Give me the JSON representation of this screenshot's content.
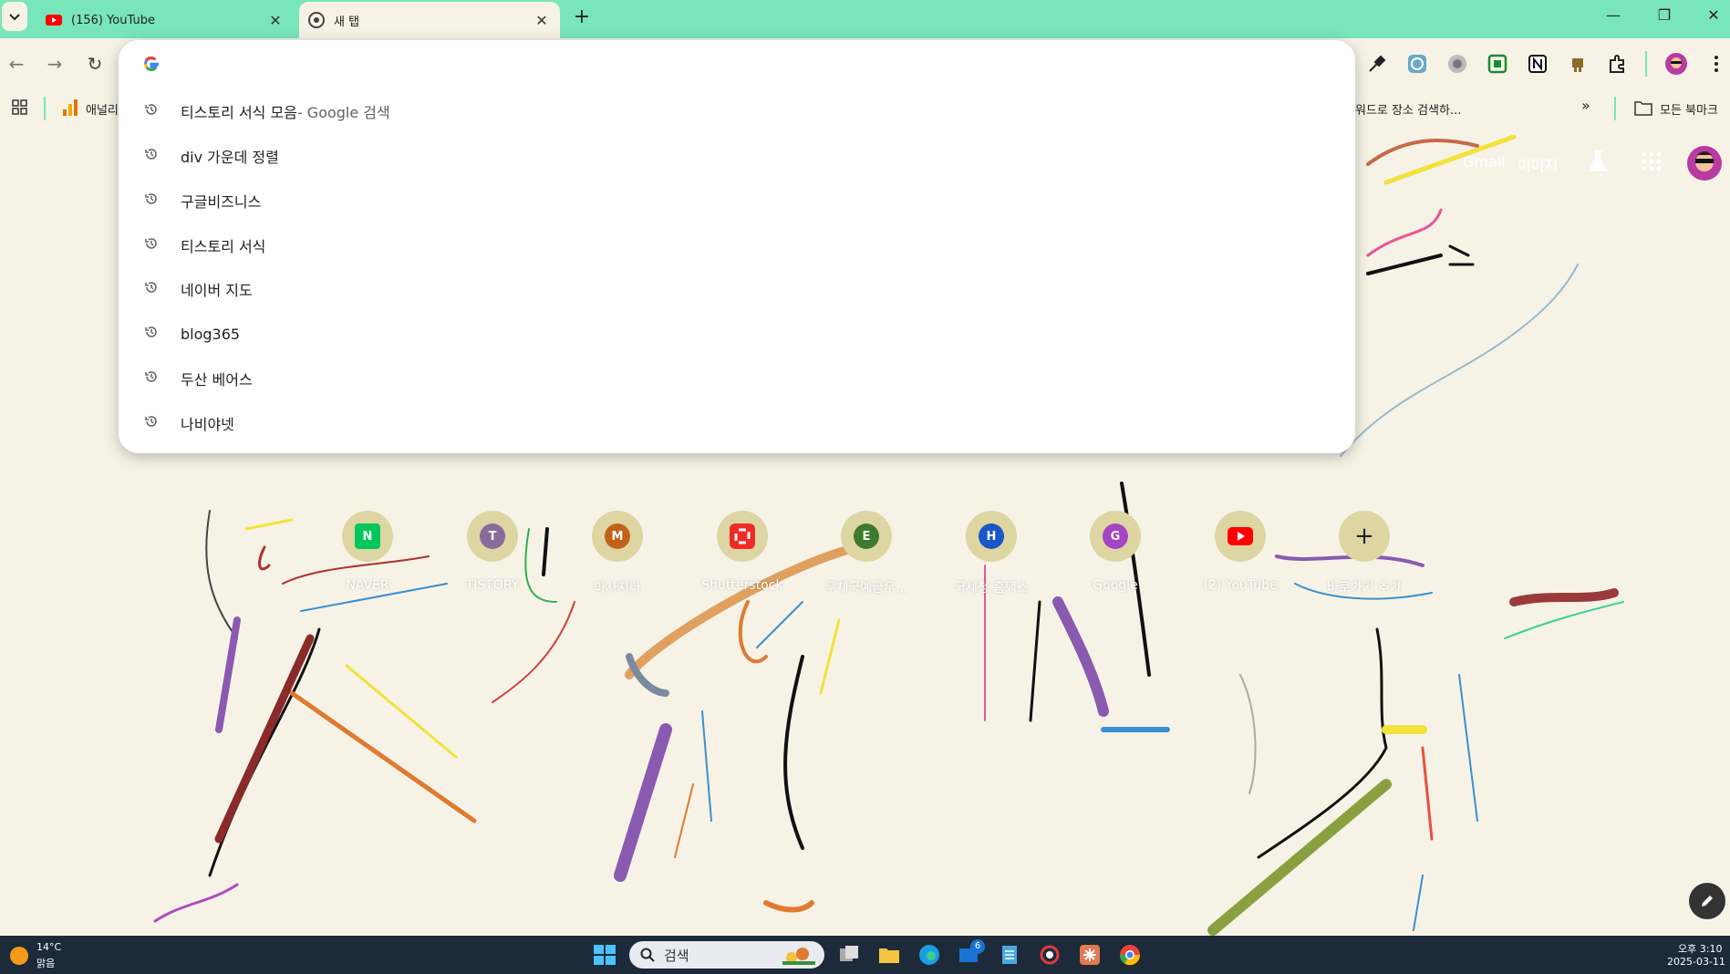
{
  "tabs": [
    {
      "title": "(156) YouTube",
      "icon": "youtube-icon",
      "active": false
    },
    {
      "title": "새 탭",
      "icon": "chrome-icon",
      "active": true
    }
  ],
  "bookmarks": {
    "first": "애널리",
    "second": "워드로 장소 검색하...",
    "all": "모든 북마크"
  },
  "omnibox": {
    "input_value": "",
    "suggestions": [
      {
        "text": "티스토리 서식 모음",
        "sub": " - Google 검색"
      },
      {
        "text": "div 가운데 정렬",
        "sub": ""
      },
      {
        "text": "구글비즈니스",
        "sub": ""
      },
      {
        "text": "티스토리 서식",
        "sub": ""
      },
      {
        "text": "네이버 지도",
        "sub": ""
      },
      {
        "text": "blog365",
        "sub": ""
      },
      {
        "text": "두산 베어스",
        "sub": ""
      },
      {
        "text": "나비야넷",
        "sub": ""
      }
    ]
  },
  "header_links": {
    "gmail": "Gmail",
    "images": "이미지"
  },
  "shortcuts": [
    {
      "label": "NAVER",
      "initial": "N",
      "color": "#03c75a"
    },
    {
      "label": "TISTORY",
      "initial": "T",
      "color": "#8a6a9a"
    },
    {
      "label": "마사지다",
      "initial": "M",
      "color": "#c2621a"
    },
    {
      "label": "Shutterstock",
      "initial": "",
      "color": "#ee2b24"
    },
    {
      "label": "우체국예금우...",
      "initial": "E",
      "color": "#3d7a2e"
    },
    {
      "label": "국세청 홈택스",
      "initial": "H",
      "color": "#1a56c8"
    },
    {
      "label": "Google",
      "initial": "G",
      "color": "#a544c5"
    },
    {
      "label": "(2) YouTube",
      "initial": "",
      "color": "#ff0000"
    },
    {
      "label": "바로가기 추가",
      "initial": "+",
      "color": ""
    }
  ],
  "taskbar": {
    "weather_temp": "14°C",
    "weather_desc": "맑음",
    "search_placeholder": "검색",
    "badge": "6",
    "time": "오후 3:10",
    "date": "2025-03-11"
  }
}
